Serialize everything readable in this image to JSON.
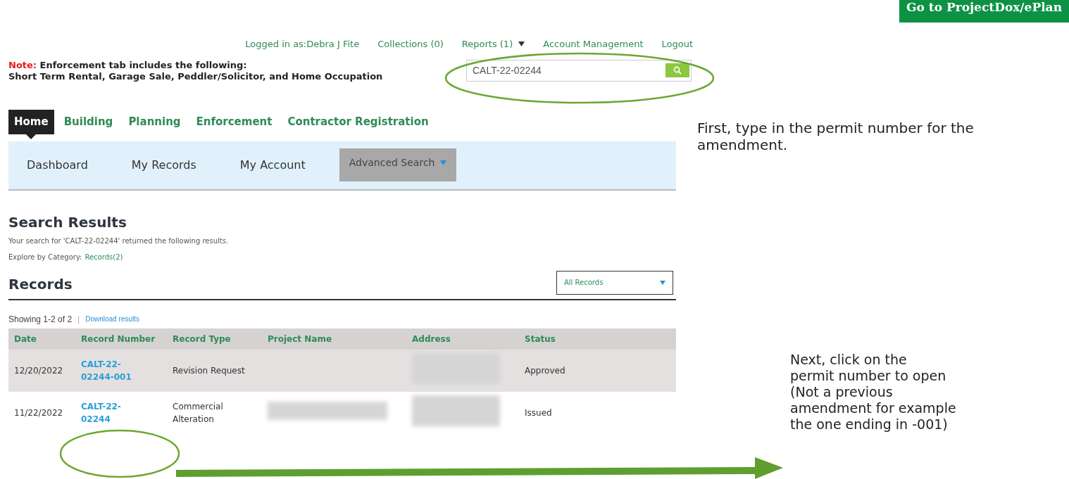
{
  "header_button": "Go to ProjectDox/ePlan",
  "top_links": [
    {
      "label": "Logged in as:Debra J Fite",
      "kind": "text"
    },
    {
      "label": "Collections (0)",
      "kind": "link"
    },
    {
      "label": "Reports (1)",
      "kind": "dropdown"
    },
    {
      "label": "Account Management",
      "kind": "link"
    },
    {
      "label": "Logout",
      "kind": "link"
    }
  ],
  "note": {
    "label": "Note:",
    "lines": [
      "Enforcement tab includes the following:",
      "Short Term Rental, Garage Sale, Peddler/Solicitor, and Home Occupation"
    ]
  },
  "search": {
    "value": "CALT-22-02244"
  },
  "tabs": [
    {
      "label": "Home",
      "selected": true
    },
    {
      "label": "Building",
      "selected": false
    },
    {
      "label": "Planning",
      "selected": false
    },
    {
      "label": "Enforcement",
      "selected": false
    },
    {
      "label": "Contractor Registration",
      "selected": false
    }
  ],
  "subnav": [
    {
      "label": "Dashboard",
      "kind": "link"
    },
    {
      "label": "My Records",
      "kind": "link"
    },
    {
      "label": "My Account",
      "kind": "link"
    },
    {
      "label": "Advanced Search",
      "kind": "dropdown"
    }
  ],
  "results": {
    "title": "Search Results",
    "message": "Your search for 'CALT-22-02244' returned the following results.",
    "explore_label": "Explore by Category:",
    "explore_link": "Records(2)"
  },
  "records": {
    "title": "Records",
    "filter": "All Records",
    "showing": "Showing 1-2 of 2",
    "separator": "|",
    "download": "Download results",
    "columns": [
      "Date",
      "Record Number",
      "Record Type",
      "Project Name",
      "Address",
      "Status"
    ],
    "rows": [
      {
        "date": "12/20/2022",
        "record_number": "CALT-22-02244-001",
        "record_type": "Revision Request",
        "project_redacted": false,
        "address_redacted": true,
        "status": "Approved"
      },
      {
        "date": "11/22/2022",
        "record_number": "CALT-22-02244",
        "record_type": "Commercial Alteration",
        "project_redacted": true,
        "address_redacted": true,
        "status": "Issued"
      }
    ]
  },
  "annotations": [
    {
      "kind": "callout",
      "text": "First, type in the permit number for the amendment."
    },
    {
      "kind": "callout",
      "text": "Next, click on the\npermit number to open\n(Not a previous\namendment for example\nthe one ending in -001)"
    }
  ]
}
